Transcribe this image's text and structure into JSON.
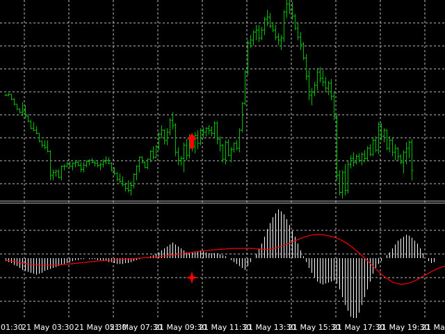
{
  "chart_data": [
    {
      "type": "ohlc",
      "panel": "price",
      "colors": {
        "bars": "#00c000",
        "signal_arrow": "#ff0000",
        "grid": "#c0c0c0",
        "background": "#000000"
      },
      "grid": true,
      "signals": [
        {
          "bar": 67,
          "kind": "buy-arrow"
        }
      ],
      "bars": [
        [
          105,
          106,
          104,
          105
        ],
        [
          105,
          107,
          104,
          106
        ],
        [
          106,
          106,
          100,
          101
        ],
        [
          101,
          102,
          95,
          96
        ],
        [
          96,
          96,
          90,
          91
        ],
        [
          91,
          92,
          87,
          88
        ],
        [
          88,
          98,
          84,
          89
        ],
        [
          89,
          95,
          82,
          84
        ],
        [
          84,
          86,
          78,
          79
        ],
        [
          79,
          80,
          71,
          72
        ],
        [
          72,
          78,
          69,
          70
        ],
        [
          70,
          74,
          66,
          67
        ],
        [
          67,
          67,
          58,
          59
        ],
        [
          59,
          60,
          53,
          55
        ],
        [
          55,
          60,
          51,
          53
        ],
        [
          53,
          60,
          48,
          49
        ],
        [
          49,
          50,
          20,
          25
        ],
        [
          25,
          31,
          20,
          28
        ],
        [
          28,
          31,
          24,
          29
        ],
        [
          29,
          31,
          22,
          23
        ],
        [
          23,
          35,
          20,
          34
        ],
        [
          34,
          36,
          30,
          34
        ],
        [
          34,
          38,
          33,
          37
        ],
        [
          37,
          39,
          33,
          34
        ],
        [
          34,
          38,
          30,
          37
        ],
        [
          37,
          40,
          33,
          38
        ],
        [
          38,
          40,
          34,
          35
        ],
        [
          35,
          38,
          28,
          31
        ],
        [
          31,
          38,
          28,
          35
        ],
        [
          35,
          40,
          33,
          39
        ],
        [
          39,
          41,
          35,
          40
        ],
        [
          40,
          42,
          37,
          38
        ],
        [
          38,
          40,
          34,
          37
        ],
        [
          37,
          39,
          33,
          35
        ],
        [
          35,
          38,
          30,
          36
        ],
        [
          36,
          41,
          33,
          39
        ],
        [
          39,
          44,
          36,
          40
        ],
        [
          40,
          43,
          36,
          37
        ],
        [
          37,
          38,
          29,
          30
        ],
        [
          30,
          33,
          25,
          27
        ],
        [
          27,
          28,
          19,
          21
        ],
        [
          21,
          27,
          17,
          19
        ],
        [
          19,
          24,
          14,
          16
        ],
        [
          16,
          18,
          9,
          12
        ],
        [
          12,
          20,
          8,
          10
        ],
        [
          10,
          19,
          5,
          15
        ],
        [
          15,
          27,
          12,
          26
        ],
        [
          26,
          35,
          20,
          34
        ],
        [
          34,
          44,
          28,
          43
        ],
        [
          43,
          44,
          37,
          38
        ],
        [
          38,
          39,
          32,
          33
        ],
        [
          33,
          42,
          31,
          41
        ],
        [
          41,
          50,
          38,
          49
        ],
        [
          49,
          54,
          41,
          43
        ],
        [
          43,
          55,
          42,
          54
        ],
        [
          54,
          68,
          50,
          66
        ],
        [
          66,
          75,
          62,
          70
        ],
        [
          70,
          71,
          56,
          60
        ],
        [
          60,
          72,
          55,
          68
        ],
        [
          68,
          82,
          65,
          80
        ],
        [
          80,
          88,
          71,
          75
        ],
        [
          75,
          77,
          44,
          48
        ],
        [
          48,
          53,
          35,
          40
        ],
        [
          40,
          44,
          35,
          42
        ],
        [
          42,
          58,
          28,
          55
        ],
        [
          55,
          61,
          40,
          45
        ],
        [
          45,
          66,
          42,
          63
        ],
        [
          63,
          67,
          49,
          54
        ],
        [
          54,
          68,
          47,
          65
        ],
        [
          65,
          70,
          51,
          57
        ],
        [
          57,
          72,
          55,
          70
        ],
        [
          70,
          73,
          62,
          68
        ],
        [
          68,
          73,
          64,
          72
        ],
        [
          72,
          75,
          66,
          70
        ],
        [
          70,
          74,
          64,
          67
        ],
        [
          67,
          79,
          62,
          77
        ],
        [
          77,
          79,
          56,
          61
        ],
        [
          61,
          64,
          49,
          55
        ],
        [
          55,
          56,
          38,
          41
        ],
        [
          41,
          60,
          36,
          58
        ],
        [
          58,
          61,
          44,
          45
        ],
        [
          45,
          53,
          38,
          51
        ],
        [
          51,
          58,
          48,
          57
        ],
        [
          57,
          60,
          50,
          52
        ],
        [
          52,
          72,
          48,
          70
        ],
        [
          70,
          98,
          68,
          97
        ],
        [
          97,
          130,
          95,
          128
        ],
        [
          128,
          160,
          125,
          157
        ],
        [
          157,
          165,
          152,
          160
        ],
        [
          160,
          170,
          155,
          168
        ],
        [
          168,
          175,
          160,
          170
        ],
        [
          170,
          175,
          158,
          162
        ],
        [
          162,
          173,
          160,
          170
        ],
        [
          170,
          183,
          165,
          181
        ],
        [
          181,
          190,
          174,
          183
        ],
        [
          183,
          187,
          172,
          174
        ],
        [
          174,
          178,
          168,
          170
        ],
        [
          170,
          175,
          160,
          163
        ],
        [
          163,
          167,
          155,
          160
        ],
        [
          160,
          165,
          150,
          162
        ],
        [
          162,
          190,
          158,
          188
        ],
        [
          188,
          200,
          182,
          196
        ],
        [
          196,
          204,
          186,
          190
        ],
        [
          190,
          198,
          180,
          184
        ],
        [
          184,
          186,
          170,
          172
        ],
        [
          172,
          178,
          160,
          163
        ],
        [
          163,
          168,
          150,
          156
        ],
        [
          156,
          158,
          140,
          142
        ],
        [
          142,
          146,
          120,
          124
        ],
        [
          124,
          130,
          100,
          105
        ],
        [
          105,
          112,
          95,
          108
        ],
        [
          108,
          118,
          104,
          115
        ],
        [
          115,
          132,
          110,
          128
        ],
        [
          128,
          133,
          118,
          122
        ],
        [
          122,
          130,
          114,
          118
        ],
        [
          118,
          123,
          108,
          112
        ],
        [
          112,
          119,
          105,
          117
        ],
        [
          117,
          121,
          100,
          104
        ],
        [
          104,
          108,
          80,
          84
        ],
        [
          84,
          86,
          20,
          25
        ],
        [
          25,
          30,
          5,
          8
        ],
        [
          8,
          30,
          2,
          28
        ],
        [
          28,
          36,
          5,
          10
        ],
        [
          10,
          39,
          7,
          36
        ],
        [
          36,
          45,
          32,
          42
        ],
        [
          42,
          48,
          34,
          38
        ],
        [
          38,
          46,
          36,
          44
        ],
        [
          44,
          47,
          38,
          40
        ],
        [
          40,
          48,
          35,
          46
        ],
        [
          46,
          50,
          38,
          42
        ],
        [
          42,
          54,
          40,
          52
        ],
        [
          52,
          56,
          44,
          46
        ],
        [
          46,
          62,
          44,
          60
        ],
        [
          60,
          64,
          48,
          50
        ],
        [
          50,
          78,
          46,
          76
        ],
        [
          76,
          77,
          60,
          64
        ],
        [
          64,
          72,
          58,
          70
        ],
        [
          70,
          71,
          50,
          52
        ],
        [
          52,
          64,
          48,
          60
        ],
        [
          60,
          62,
          44,
          48
        ],
        [
          48,
          56,
          40,
          52
        ],
        [
          52,
          53,
          40,
          44
        ],
        [
          44,
          46,
          36,
          38
        ],
        [
          38,
          50,
          27,
          48
        ],
        [
          48,
          58,
          36,
          52
        ],
        [
          52,
          60,
          42,
          58
        ],
        [
          58,
          61,
          20,
          30
        ]
      ]
    },
    {
      "type": "histogram",
      "panel": "oscillator",
      "colors": {
        "histogram": "#ffffff",
        "signal_line": "#ff0000",
        "star": "#ff0000"
      },
      "grid": true,
      "signals": [
        {
          "bar": 67,
          "kind": "star"
        }
      ],
      "histogram": [
        -3,
        -4,
        -5,
        -7,
        -8,
        -10,
        -12,
        -13,
        -14,
        -15,
        -16,
        -17,
        -16,
        -15,
        -13,
        -12,
        -11,
        -10,
        -9,
        -8,
        -7,
        -6,
        -5,
        -4,
        -3,
        -2,
        -2,
        -1,
        -1,
        0,
        -1,
        -1,
        -1,
        -2,
        -2,
        -3,
        -3,
        -4,
        -4,
        -5,
        -6,
        -6,
        -6,
        -5,
        -5,
        -4,
        -3,
        -2,
        -1,
        0,
        0,
        1,
        2,
        3,
        4,
        6,
        8,
        10,
        12,
        14,
        16,
        14,
        12,
        10,
        8,
        6,
        5,
        6,
        6,
        7,
        8,
        7,
        6,
        5,
        5,
        5,
        5,
        4,
        3,
        2,
        0,
        -2,
        -4,
        -6,
        -8,
        -10,
        -12,
        -8,
        -4,
        0,
        4,
        10,
        15,
        22,
        30,
        36,
        42,
        46,
        50,
        48,
        45,
        40,
        34,
        28,
        22,
        15,
        8,
        2,
        -4,
        -10,
        -15,
        -20,
        -24,
        -26,
        -27,
        -26,
        -25,
        -24,
        -23,
        -26,
        -32,
        -40,
        -48,
        -54,
        -60,
        -64,
        -62,
        -56,
        -48,
        -40,
        -32,
        -24,
        -16,
        -10,
        -6,
        -3,
        0,
        3,
        6,
        10,
        14,
        18,
        20,
        22,
        24,
        23,
        21,
        18,
        15,
        10,
        5,
        0,
        -3,
        -5,
        -4
      ],
      "signal_line": [
        -2,
        -2.5,
        -3,
        -3.5,
        -4,
        -4.5,
        -5,
        -5.5,
        -6,
        -6.3,
        -6.6,
        -6.8,
        -7,
        -7.1,
        -7.2,
        -7.2,
        -7.2,
        -7.1,
        -7,
        -6.8,
        -6.6,
        -6.4,
        -6.2,
        -6,
        -5.7,
        -5.4,
        -5.1,
        -4.8,
        -4.5,
        -4.2,
        -3.9,
        -3.6,
        -3.3,
        -3,
        -2.8,
        -2.6,
        -2.4,
        -2.2,
        -2,
        -1.8,
        -1.6,
        -1.4,
        -1.2,
        -1,
        -0.8,
        -0.6,
        -0.4,
        -0.2,
        0,
        0.2,
        0.4,
        0.6,
        0.8,
        1,
        1.2,
        1.5,
        1.8,
        2.1,
        2.4,
        2.8,
        3.2,
        3.6,
        4,
        4.4,
        4.8,
        5.2,
        5.6,
        6,
        6.4,
        6.8,
        7.2,
        7.5,
        7.8,
        8.1,
        8.4,
        8.6,
        8.8,
        9,
        9.2,
        9.4,
        9.6,
        9.8,
        10,
        10,
        10,
        10,
        10,
        10,
        10,
        9.8,
        9.6,
        9.4,
        9.2,
        9,
        9,
        9.2,
        9.6,
        10.2,
        11,
        12,
        13,
        14.2,
        15.4,
        16.6,
        17.8,
        19,
        20.2,
        21.2,
        22.2,
        23,
        23.6,
        24,
        24.2,
        24.2,
        24,
        23.6,
        23,
        22.4,
        21.6,
        20.6,
        19.4,
        18,
        16.4,
        14.6,
        12.6,
        10.4,
        8,
        5.6,
        3,
        0.4,
        -2.4,
        -5.2,
        -8,
        -10.8,
        -13.4,
        -16,
        -18.4,
        -20.6,
        -22.6,
        -24.2,
        -25.4,
        -26.2,
        -26.6,
        -26.6,
        -26.2,
        -25.6,
        -24.6,
        -23.4,
        -22,
        -20.4,
        -18.8,
        -17.2,
        -15.6,
        -14,
        -12.6,
        -11.2,
        -10,
        -9,
        -8.2,
        -7.6,
        -7,
        -6.6,
        -6.3,
        -6.1,
        -6,
        -6,
        -6,
        -6,
        -6,
        -6
      ]
    }
  ],
  "x_axis": {
    "tick_labels": [
      "01:30",
      "21 May 03:30",
      "21 May 05:30",
      "21 May 07:30",
      "21 May 09:30",
      "21 May 11:30",
      "21 May 13:30",
      "21 May 15:30",
      "21 May 17:30",
      "21 May 19:30",
      "21 May"
    ]
  }
}
